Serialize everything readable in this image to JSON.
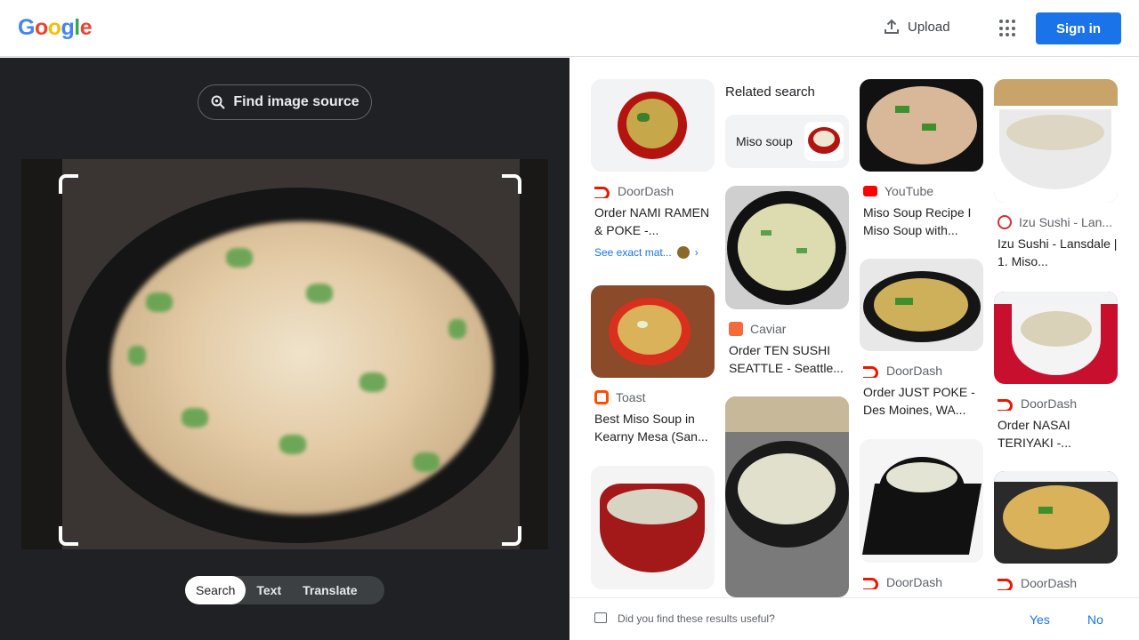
{
  "header": {
    "logo_letters": [
      "G",
      "o",
      "o",
      "g",
      "l",
      "e"
    ],
    "logo_colors": [
      "#4285F4",
      "#EA4335",
      "#FBBC05",
      "#4285F4",
      "#34A853",
      "#EA4335"
    ],
    "upload_label": "Upload",
    "signin_label": "Sign in"
  },
  "left_panel": {
    "find_source_label": "Find image source",
    "tabs": [
      {
        "label": "Search",
        "active": true
      },
      {
        "label": "Text",
        "active": false
      },
      {
        "label": "Translate",
        "active": false
      }
    ]
  },
  "related": {
    "title": "Related search",
    "chip_label": "Miso soup"
  },
  "results": [
    {
      "source": "DoorDash",
      "title": "Order NAMI RAMEN & POKE -...",
      "icon": "doordash-icon",
      "exact_label": "See exact mat..."
    },
    {
      "source": "Toast",
      "title": "Best Miso Soup in Kearny Mesa (San...",
      "icon": "toast-icon"
    },
    {
      "source": "Caviar",
      "title": "Order TEN SUSHI SEATTLE - Seattle...",
      "icon": "caviar-icon"
    },
    {
      "source": "YouTube",
      "title": "Miso Soup Recipe I Miso Soup with...",
      "icon": "youtube-icon"
    },
    {
      "source": "DoorDash",
      "title": "Order JUST POKE - Des Moines, WA...",
      "icon": "doordash-icon"
    },
    {
      "source": "DoorDash",
      "title": "",
      "icon": "doordash-icon"
    },
    {
      "source": "Izu Sushi - Lan...",
      "title": "Izu Sushi - Lansdale | 1. Miso...",
      "icon": "izu-sushi-icon"
    },
    {
      "source": "DoorDash",
      "title": "Order NASAI TERIYAKI -...",
      "icon": "doordash-icon"
    },
    {
      "source": "DoorDash",
      "title": "",
      "icon": "doordash-icon"
    }
  ],
  "feedback": {
    "question": "Did you find these results useful?",
    "yes_label": "Yes",
    "no_label": "No"
  },
  "colors": {
    "accent": "#1a73e8",
    "left_bg": "#202124",
    "doordash": "#eb1700"
  }
}
